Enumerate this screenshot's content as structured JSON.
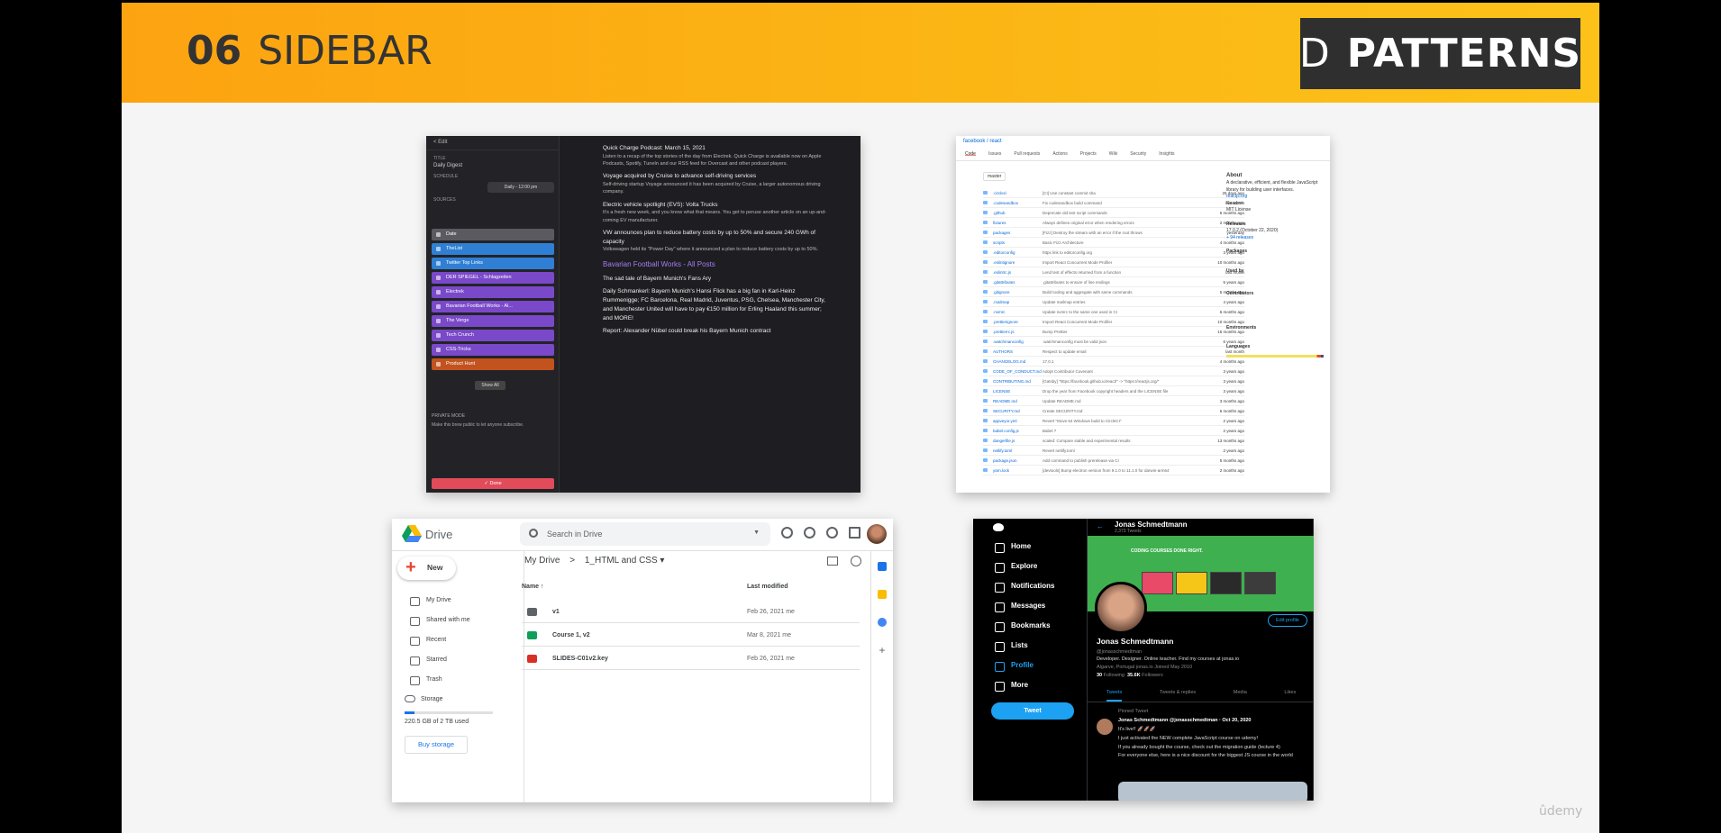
{
  "slide": {
    "number": "06",
    "title": "SIDEBAR"
  },
  "logo": {
    "letter": "D",
    "text": "PATTERNS"
  },
  "watermark": "ûdemy",
  "c1": {
    "topbar": "< Edit",
    "title_label": "TITLE",
    "title_value": "Daily Digest",
    "schedule_label": "SCHEDULE",
    "schedule_value": "Daily - 12:00 pm",
    "sources_label": "SOURCES",
    "sources": [
      {
        "label": "Date",
        "color": "#5a5a60"
      },
      {
        "label": "TheList",
        "color": "#2f7fd4"
      },
      {
        "label": "Twitter Top Links",
        "color": "#2f7fd4"
      },
      {
        "label": "DER SPIEGEL - Schlagzeilen",
        "color": "#7a49c9"
      },
      {
        "label": "Electrek",
        "color": "#7a49c9"
      },
      {
        "label": "Bavarian Football Works - Al...",
        "color": "#7a49c9"
      },
      {
        "label": "The Verge",
        "color": "#7a49c9"
      },
      {
        "label": "Tech Crunch",
        "color": "#7a49c9"
      },
      {
        "label": "CSS-Tricks",
        "color": "#7a49c9"
      },
      {
        "label": "Product Hunt",
        "color": "#c2531e"
      }
    ],
    "show_all": "Show All",
    "private_mode": "PRIVATE MODE",
    "private_text": "Make this brew public to let anyone subscribe.",
    "done": "✓ Done",
    "feed": [
      {
        "t": "h",
        "v": "Quick Charge Podcast: March 15, 2021"
      },
      {
        "t": "s",
        "v": "Listen to a recap of the top stories of the day from Electrek. Quick Charge is available now on Apple Podcasts, Spotify, TuneIn and our RSS feed for Overcast and other podcast players."
      },
      {
        "t": "h",
        "v": "Voyage acquired by Cruise to advance self-driving services"
      },
      {
        "t": "s",
        "v": "Self-driving startup Voyage announced it has been acquired by Cruise, a larger autonomous driving company."
      },
      {
        "t": "h",
        "v": "Electric vehicle spotlight (EVS): Volta Trucks"
      },
      {
        "t": "s",
        "v": "It's a fresh new week, and you know what that means. You get to peruse another article on an up-and-coming EV manufacturer."
      },
      {
        "t": "h",
        "v": "VW announces plan to reduce battery costs by up to 50% and secure 240 GWh of capacity"
      },
      {
        "t": "s",
        "v": "Volkswagen held its \"Power Day\" where it announced a plan to reduce battery costs by up to 50%."
      },
      {
        "t": "p",
        "v": "Bavarian Football Works - All Posts"
      },
      {
        "t": "h",
        "v": "The sad tale of Bayern Munich's Fans Ary"
      },
      {
        "t": "h",
        "v": "Daily Schmankerl: Bayern Munich's Hansi Flick has a big fan in Karl-Heinz Rummenigge; FC Barcelona, Real Madrid, Juventus, PSG, Chelsea, Manchester City, and Manchester United will have to pay €150 million for Erling Haaland this summer; and MORE!"
      },
      {
        "t": "h",
        "v": "Report: Alexander Nübel could break his Bayern Munich contract"
      }
    ]
  },
  "c2": {
    "repo": "facebook / react",
    "tabs": [
      "Code",
      "Issues",
      "Pull requests",
      "Actions",
      "Projects",
      "Wiki",
      "Security",
      "Insights"
    ],
    "branch": "master",
    "files": [
      {
        "name": ".circleci",
        "msg": "[CI] Use constant commit sha",
        "age": "25 days ago"
      },
      {
        "name": ".codesandbox",
        "msg": "Fix codesandbox build command",
        "age": "last month"
      },
      {
        "name": ".github",
        "msg": "Deprecate old test script commands",
        "age": "6 months ago"
      },
      {
        "name": "fixtures",
        "msg": "Always defines original error when rendering errors",
        "age": "2 months ago"
      },
      {
        "name": "packages",
        "msg": "[Fizz] Destroy the stream with an error if the root throws",
        "age": "yesterday"
      },
      {
        "name": "scripts",
        "msg": "Basic Fizz Architecture",
        "age": "4 months ago"
      },
      {
        "name": ".editorconfig",
        "msg": "https link to editorconfig.org",
        "age": "3 years ago"
      },
      {
        "name": ".eslintignore",
        "msg": "Import React Concurrent Mode Profiler",
        "age": "10 months ago"
      },
      {
        "name": ".eslintrc.js",
        "msg": "Lend test of effects returned from a function",
        "age": "last month"
      },
      {
        "name": ".gitattributes",
        "msg": ".gitattributes to ensure of line endings",
        "age": "5 years ago"
      },
      {
        "name": ".gitignore",
        "msg": "Build tooling and aggregate with same commands",
        "age": "5 months ago"
      },
      {
        "name": ".mailmap",
        "msg": "Update mailmap entries",
        "age": "4 years ago"
      },
      {
        "name": ".nvmrc",
        "msg": "Update nvmrc to the same one used in CI",
        "age": "6 months ago"
      },
      {
        "name": ".prettierignore",
        "msg": "Import React Concurrent Mode Profiler",
        "age": "10 months ago"
      },
      {
        "name": ".prettierrc.js",
        "msg": "Bump Prettier",
        "age": "16 months ago"
      },
      {
        "name": ".watchmanconfig",
        "msg": ".watchmanconfig must be valid json",
        "age": "6 years ago"
      },
      {
        "name": "AUTHORS",
        "msg": "Respect to update email",
        "age": "last month"
      },
      {
        "name": "CHANGELOG.md",
        "msg": "17.0.1",
        "age": "4 months ago"
      },
      {
        "name": "CODE_OF_CONDUCT.md",
        "msg": "Adopt Contributor Covenant",
        "age": "3 years ago"
      },
      {
        "name": "CONTRIBUTING.md",
        "msg": "[Gatsby] \"https://facebook.github.io/react/\" -> \"https://reactjs.org/\"",
        "age": "3 years ago"
      },
      {
        "name": "LICENSE",
        "msg": "Drop the year from Facebook copyright headers and the LICENSE file",
        "age": "3 years ago"
      },
      {
        "name": "README.md",
        "msg": "Update README.md",
        "age": "3 months ago"
      },
      {
        "name": "SECURITY.md",
        "msg": "Create SECURITY.md",
        "age": "6 months ago"
      },
      {
        "name": "appveyor.yml",
        "msg": "Revert \"Move 64 Windows build to CircleCI\"",
        "age": "2 years ago"
      },
      {
        "name": "babel.config.js",
        "msg": "Babel 7",
        "age": "2 years ago"
      },
      {
        "name": "dangerfile.js",
        "msg": "scaled: Compare stable and experimental results",
        "age": "13 months ago"
      },
      {
        "name": "netlify.toml",
        "msg": "Revert netlify.toml",
        "age": "2 years ago"
      },
      {
        "name": "package.json",
        "msg": "Add command to publish prerelease via CI",
        "age": "5 months ago"
      },
      {
        "name": "yarn.lock",
        "msg": "[devtools] Bump electron version from 9.1.0 to 11.1.0 for darwin-arm64",
        "age": "2 months ago"
      }
    ],
    "about_title": "About",
    "about_text": "A declarative, efficient, and flexible JavaScript library for building user interfaces.",
    "link": "reactjs.org",
    "readme": "Readme",
    "license": "MIT License",
    "releases": "Releases",
    "release": "17.0.2 (October 22, 2020)",
    "more_releases": "+ 94 releases",
    "packages": "Packages",
    "used_by": "Used by",
    "contributors": "Contributors",
    "environments": "Environments",
    "languages": "Languages"
  },
  "c3": {
    "app_name": "Drive",
    "search_placeholder": "Search in Drive",
    "new_label": "New",
    "nav": [
      "My Drive",
      "Shared with me",
      "Recent",
      "Starred",
      "Trash"
    ],
    "storage_label": "Storage",
    "storage_used": "220.5 GB of 2 TB used",
    "storage_fraction": 0.11,
    "buy_storage": "Buy storage",
    "crumb_root": "My Drive",
    "crumb_sep": ">",
    "crumb_current": "1_HTML and CSS ▾",
    "col_name": "Name ↑",
    "col_modified": "Last modified",
    "files": [
      {
        "name": "v1",
        "date": "Feb 26, 2021  me",
        "color": "#5f6368"
      },
      {
        "name": "Course 1, v2",
        "date": "Mar 8, 2021  me",
        "color": "#0f9d58"
      },
      {
        "name": "SLIDES-C01v2.key",
        "date": "Feb 26, 2021  me",
        "color": "#d93025"
      }
    ]
  },
  "c4": {
    "nav": [
      "Home",
      "Explore",
      "Notifications",
      "Messages",
      "Bookmarks",
      "Lists",
      "Profile",
      "More"
    ],
    "tweet_button": "Tweet",
    "header_name": "Jonas Schmedtmann",
    "header_tweets": "2,373 Tweets",
    "banner_text": "CODING COURSES DONE RIGHT.",
    "edit_profile": "Edit profile",
    "name": "Jonas Schmedtmann",
    "handle": "@jonasschmedtman",
    "bio": "Developer. Designer. Online teacher. Find my courses at jonas.io",
    "meta": "Algarve, Portugal   jonas.io   Joined May 2010",
    "following": "30",
    "following_label": "Following",
    "followers": "35.6K",
    "followers_label": "Followers",
    "tabs": [
      "Tweets",
      "Tweets & replies",
      "Media",
      "Likes"
    ],
    "pinned": "Pinned Tweet",
    "tweet_author": "Jonas Schmedtmann @jonasschmedtman · Oct 20, 2020",
    "tweet_lines": [
      "It's live!! 🚀🚀🚀",
      "I just activated the NEW complete JavaScript course on udemy!",
      "If you already bought the course, check out the migration guide (lecture 4)",
      "For everyone else, here is a nice discount for the biggest JS course in the world"
    ]
  }
}
